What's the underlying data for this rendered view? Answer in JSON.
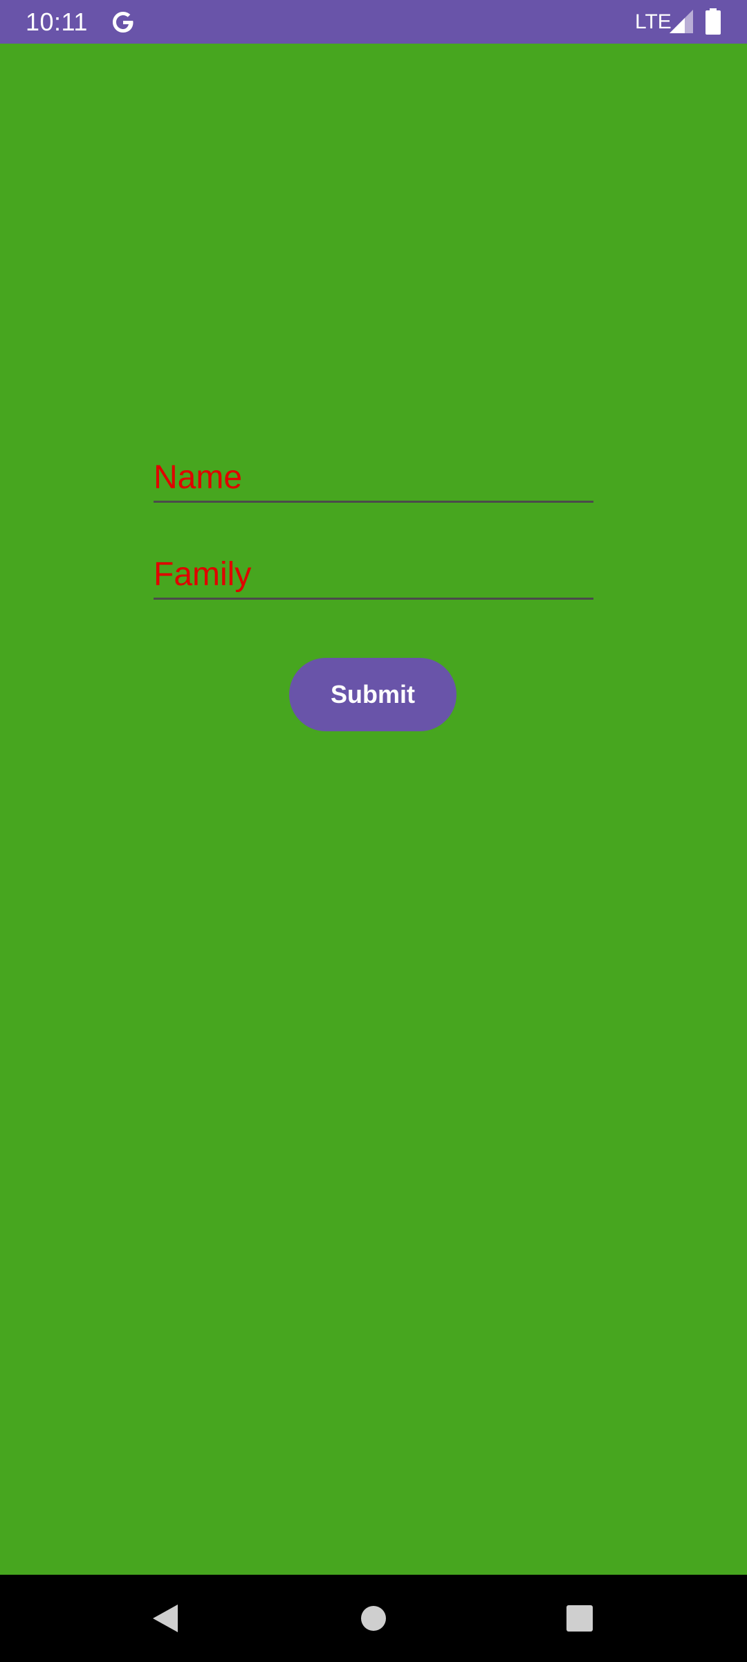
{
  "status_bar": {
    "time": "10:11",
    "network": "LTE",
    "icons": [
      "google-g-icon",
      "signal-icon",
      "battery-icon"
    ]
  },
  "form": {
    "name_placeholder": "Name",
    "name_value": "",
    "family_placeholder": "Family",
    "family_value": "",
    "submit_label": "Submit"
  },
  "nav_bar": {
    "icons": [
      "back-icon",
      "home-icon",
      "recents-icon"
    ]
  },
  "colors": {
    "background": "#47a61f",
    "accent": "#6954a9",
    "hint_text": "#e00000",
    "nav_background": "#000000"
  }
}
